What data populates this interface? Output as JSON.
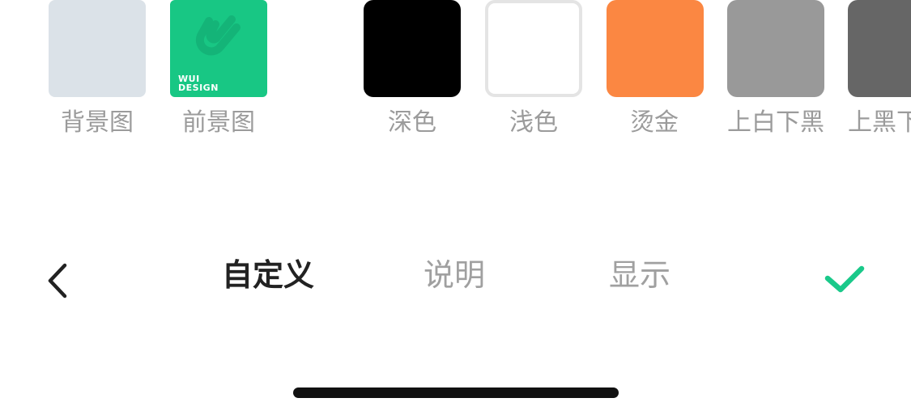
{
  "swatches": [
    {
      "key": "background",
      "label": "背景图",
      "color": "#dbe2e8"
    },
    {
      "key": "foreground",
      "label": "前景图",
      "color": "#18c784",
      "logo_text_line1": "WUI",
      "logo_text_line2": "DESIGN"
    },
    {
      "key": "dark",
      "label": "深色",
      "color": "#000000"
    },
    {
      "key": "light",
      "label": "浅色",
      "color": "#ffffff",
      "border_color": "#e4e4e4"
    },
    {
      "key": "gold",
      "label": "烫金",
      "color": "#fb8742"
    },
    {
      "key": "white_top_black_bottom",
      "label": "上白下黑",
      "color": "#999999"
    },
    {
      "key": "black_top_white_bottom",
      "label": "上黑下",
      "color": "#666666"
    }
  ],
  "toolbar": {
    "back_icon": "chevron-left-icon",
    "tabs": [
      {
        "label": "自定义",
        "active": true
      },
      {
        "label": "说明",
        "active": false
      },
      {
        "label": "显示",
        "active": false
      }
    ],
    "confirm_icon": "check-icon",
    "confirm_color": "#1ac98a"
  }
}
